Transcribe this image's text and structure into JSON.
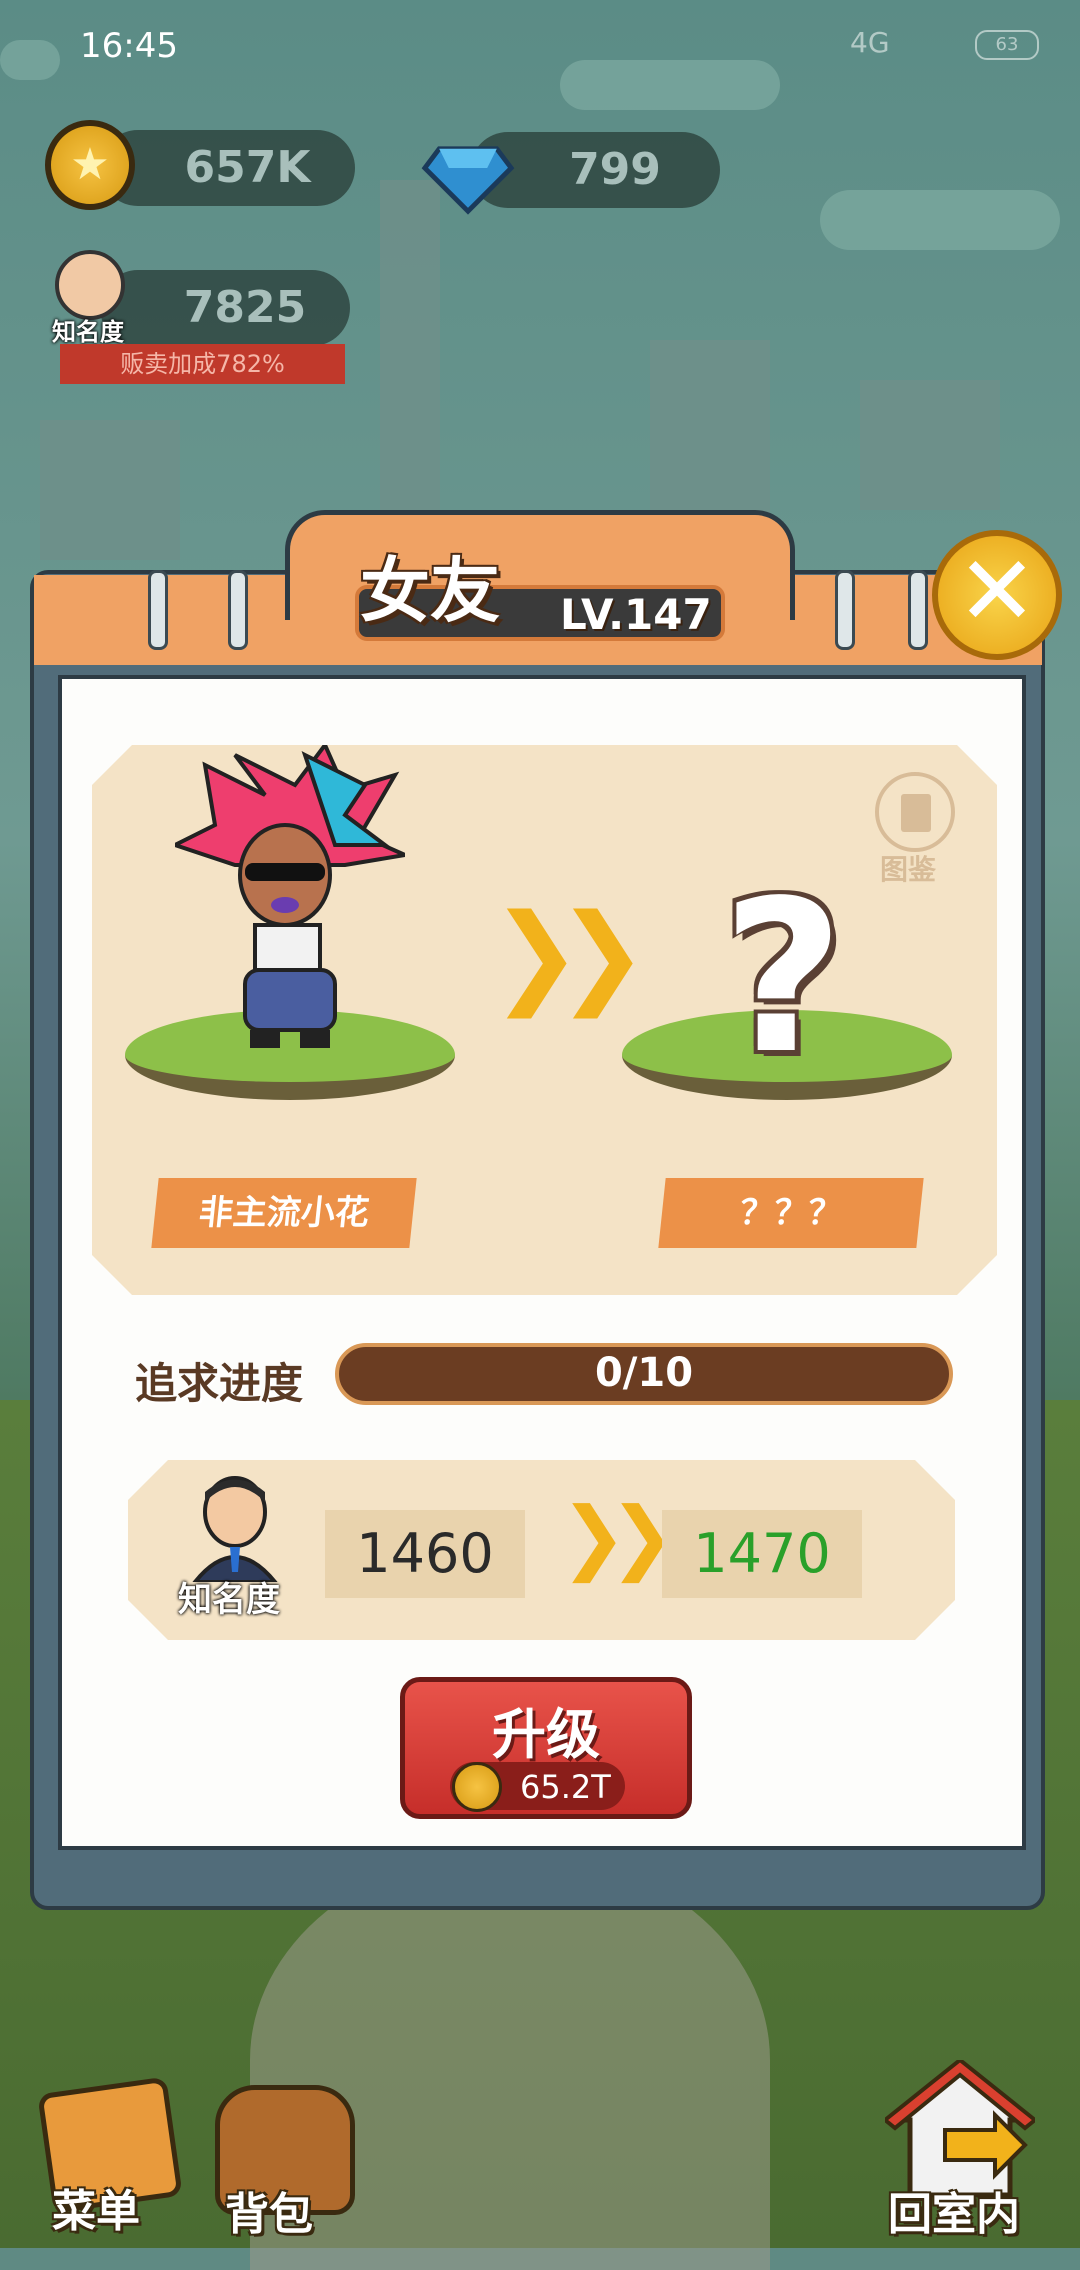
{
  "status_bar": {
    "time": "16:45",
    "network": "4G",
    "battery": "63"
  },
  "resources": {
    "coins": "657K",
    "gems": "799",
    "fame_value": "7825",
    "fame_label": "知名度",
    "sales_bonus": "贩卖加成782%"
  },
  "dialog": {
    "title": "女友",
    "level": "LV.147",
    "book_label": "图鉴",
    "current_name": "非主流小花",
    "next_name": "？？？",
    "progress_label": "追求进度",
    "progress_text": "0/10",
    "progress": {
      "current": 0,
      "total": 10
    },
    "fame_label": "知名度",
    "fame_current": "1460",
    "fame_next": "1470",
    "upgrade_label": "升级",
    "upgrade_cost": "65.2T"
  },
  "bottom_nav": {
    "menu": "菜单",
    "backpack": "背包",
    "home": "回室内"
  },
  "colors": {
    "accent_orange": "#f0a264",
    "upgrade_red": "#d63a34",
    "next_value_green": "#2aa02a",
    "progress_fill": "#6b3d22"
  }
}
